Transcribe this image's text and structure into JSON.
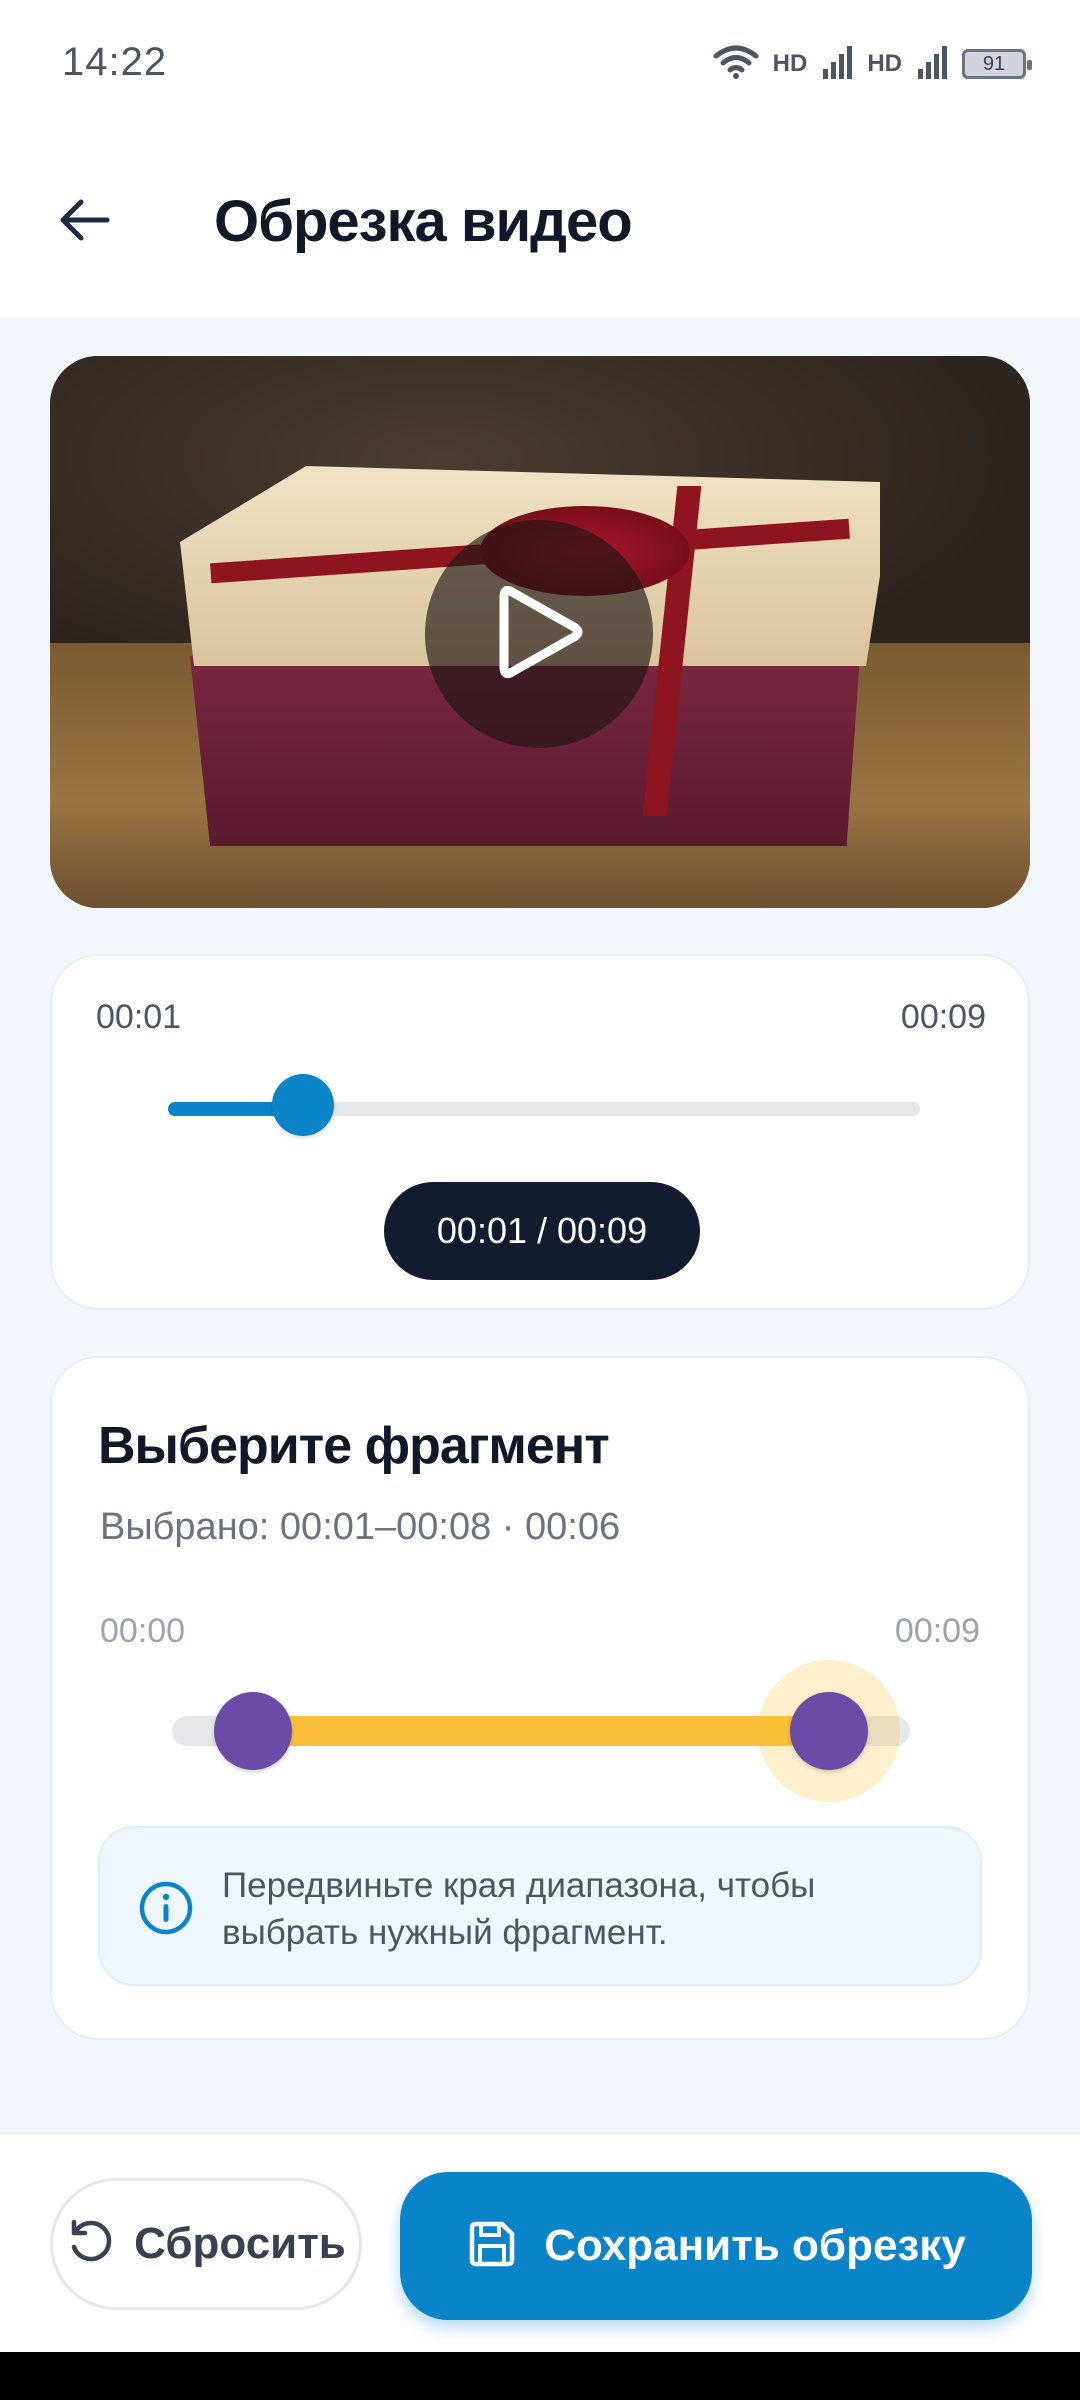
{
  "status_bar": {
    "time": "14:22",
    "network_1": "HD",
    "network_2": "HD",
    "battery": "91"
  },
  "header": {
    "title": "Обрезка видео",
    "back_icon": "arrow-left-icon"
  },
  "video": {
    "play_icon": "play-icon"
  },
  "playback": {
    "start_label": "00:01",
    "end_label": "00:09",
    "position_fraction": 0.18,
    "time_display": "00:01 / 00:09",
    "accent_color": "#0a84c9"
  },
  "fragment": {
    "title": "Выберите фрагмент",
    "summary": "Выбрано: 00:01–00:08 · 00:06",
    "range_start_label": "00:00",
    "range_end_label": "00:09",
    "selection_start_fraction": 0.11,
    "selection_end_fraction": 0.89,
    "handle_color": "#6a4ba6",
    "selection_color": "#fbbf39",
    "info_icon": "info-icon",
    "info_text": "Передвиньте края диапазона, чтобы выбрать нужный фрагмент."
  },
  "actions": {
    "reset_label": "Сбросить",
    "reset_icon": "reset-icon",
    "save_label": "Сохранить обрезку",
    "save_icon": "save-icon"
  }
}
